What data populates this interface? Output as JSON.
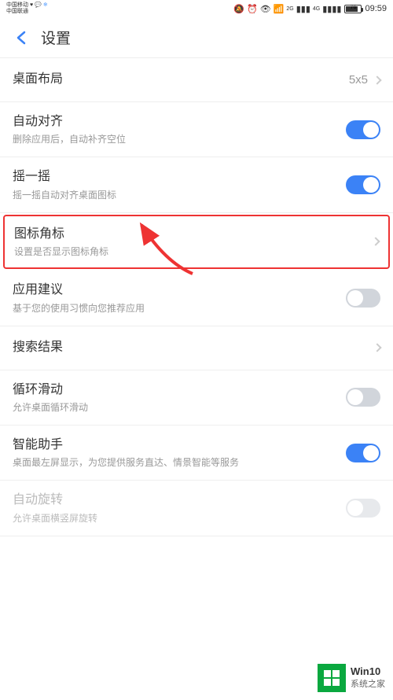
{
  "status_bar": {
    "carrier1": "中国移动",
    "carrier2": "中国联通",
    "signal_small": "2G",
    "signal_main": "4G",
    "battery_pct": "76",
    "time": "09:59"
  },
  "header": {
    "title": "设置"
  },
  "items": [
    {
      "title": "桌面布局",
      "sub": "",
      "type": "nav",
      "value": "5x5"
    },
    {
      "title": "自动对齐",
      "sub": "删除应用后，自动补齐空位",
      "type": "toggle",
      "on": true
    },
    {
      "title": "摇一摇",
      "sub": "摇一摇自动对齐桌面图标",
      "type": "toggle",
      "on": true
    },
    {
      "title": "图标角标",
      "sub": "设置是否显示图标角标",
      "type": "nav",
      "highlighted": true
    },
    {
      "title": "应用建议",
      "sub": "基于您的使用习惯向您推荐应用",
      "type": "toggle",
      "on": false
    },
    {
      "title": "搜索结果",
      "sub": "",
      "type": "nav"
    },
    {
      "title": "循环滑动",
      "sub": "允许桌面循环滑动",
      "type": "toggle",
      "on": false
    },
    {
      "title": "智能助手",
      "sub": "桌面最左屏显示，为您提供服务直达、情景智能等服务",
      "type": "toggle",
      "on": true
    },
    {
      "title": "自动旋转",
      "sub": "允许桌面横竖屏旋转",
      "type": "toggle",
      "on": false,
      "disabled": true
    }
  ],
  "watermark": {
    "line1": "Win10",
    "line2": "系统之家"
  }
}
